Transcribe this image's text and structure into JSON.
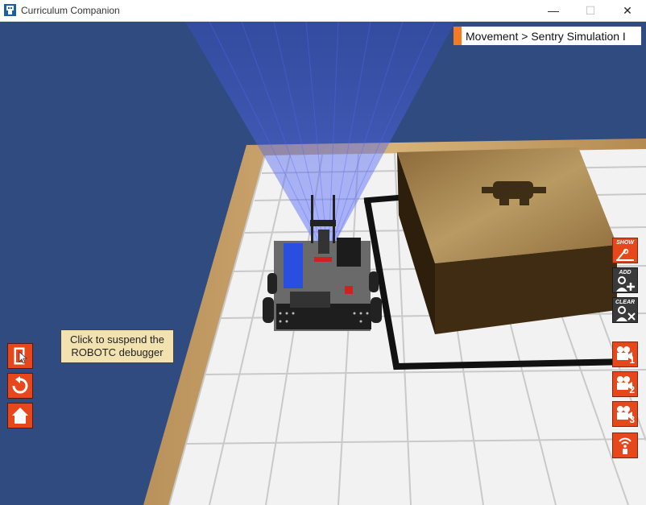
{
  "window": {
    "title": "Curriculum Companion",
    "controls": {
      "minimize": "—",
      "maximize": "☐",
      "close": "✕"
    }
  },
  "breadcrumb": {
    "text": "Movement > Sentry Simulation I",
    "accent_color": "#f47b20"
  },
  "tooltip": {
    "line1": "Click to suspend the",
    "line2": "ROBOTC debugger"
  },
  "left_toolbar": {
    "items": [
      {
        "name": "suspend-debugger-button",
        "icon": "pointer-door-icon"
      },
      {
        "name": "reset-button",
        "icon": "refresh-icon"
      },
      {
        "name": "home-button",
        "icon": "home-icon"
      }
    ]
  },
  "right_toolbar": {
    "show_label": "SHOW",
    "add_label": "ADD",
    "clear_label": "CLEAR",
    "camera_1": "1",
    "camera_2": "2",
    "camera_3": "3"
  },
  "colors": {
    "sky": "#2f4b80",
    "button_orange": "#e8471c",
    "button_dark": "#3a3a3a",
    "table_wood": "#c8a060",
    "tile_white": "#f4f4f4",
    "box_brown": "#5a3f1c"
  }
}
